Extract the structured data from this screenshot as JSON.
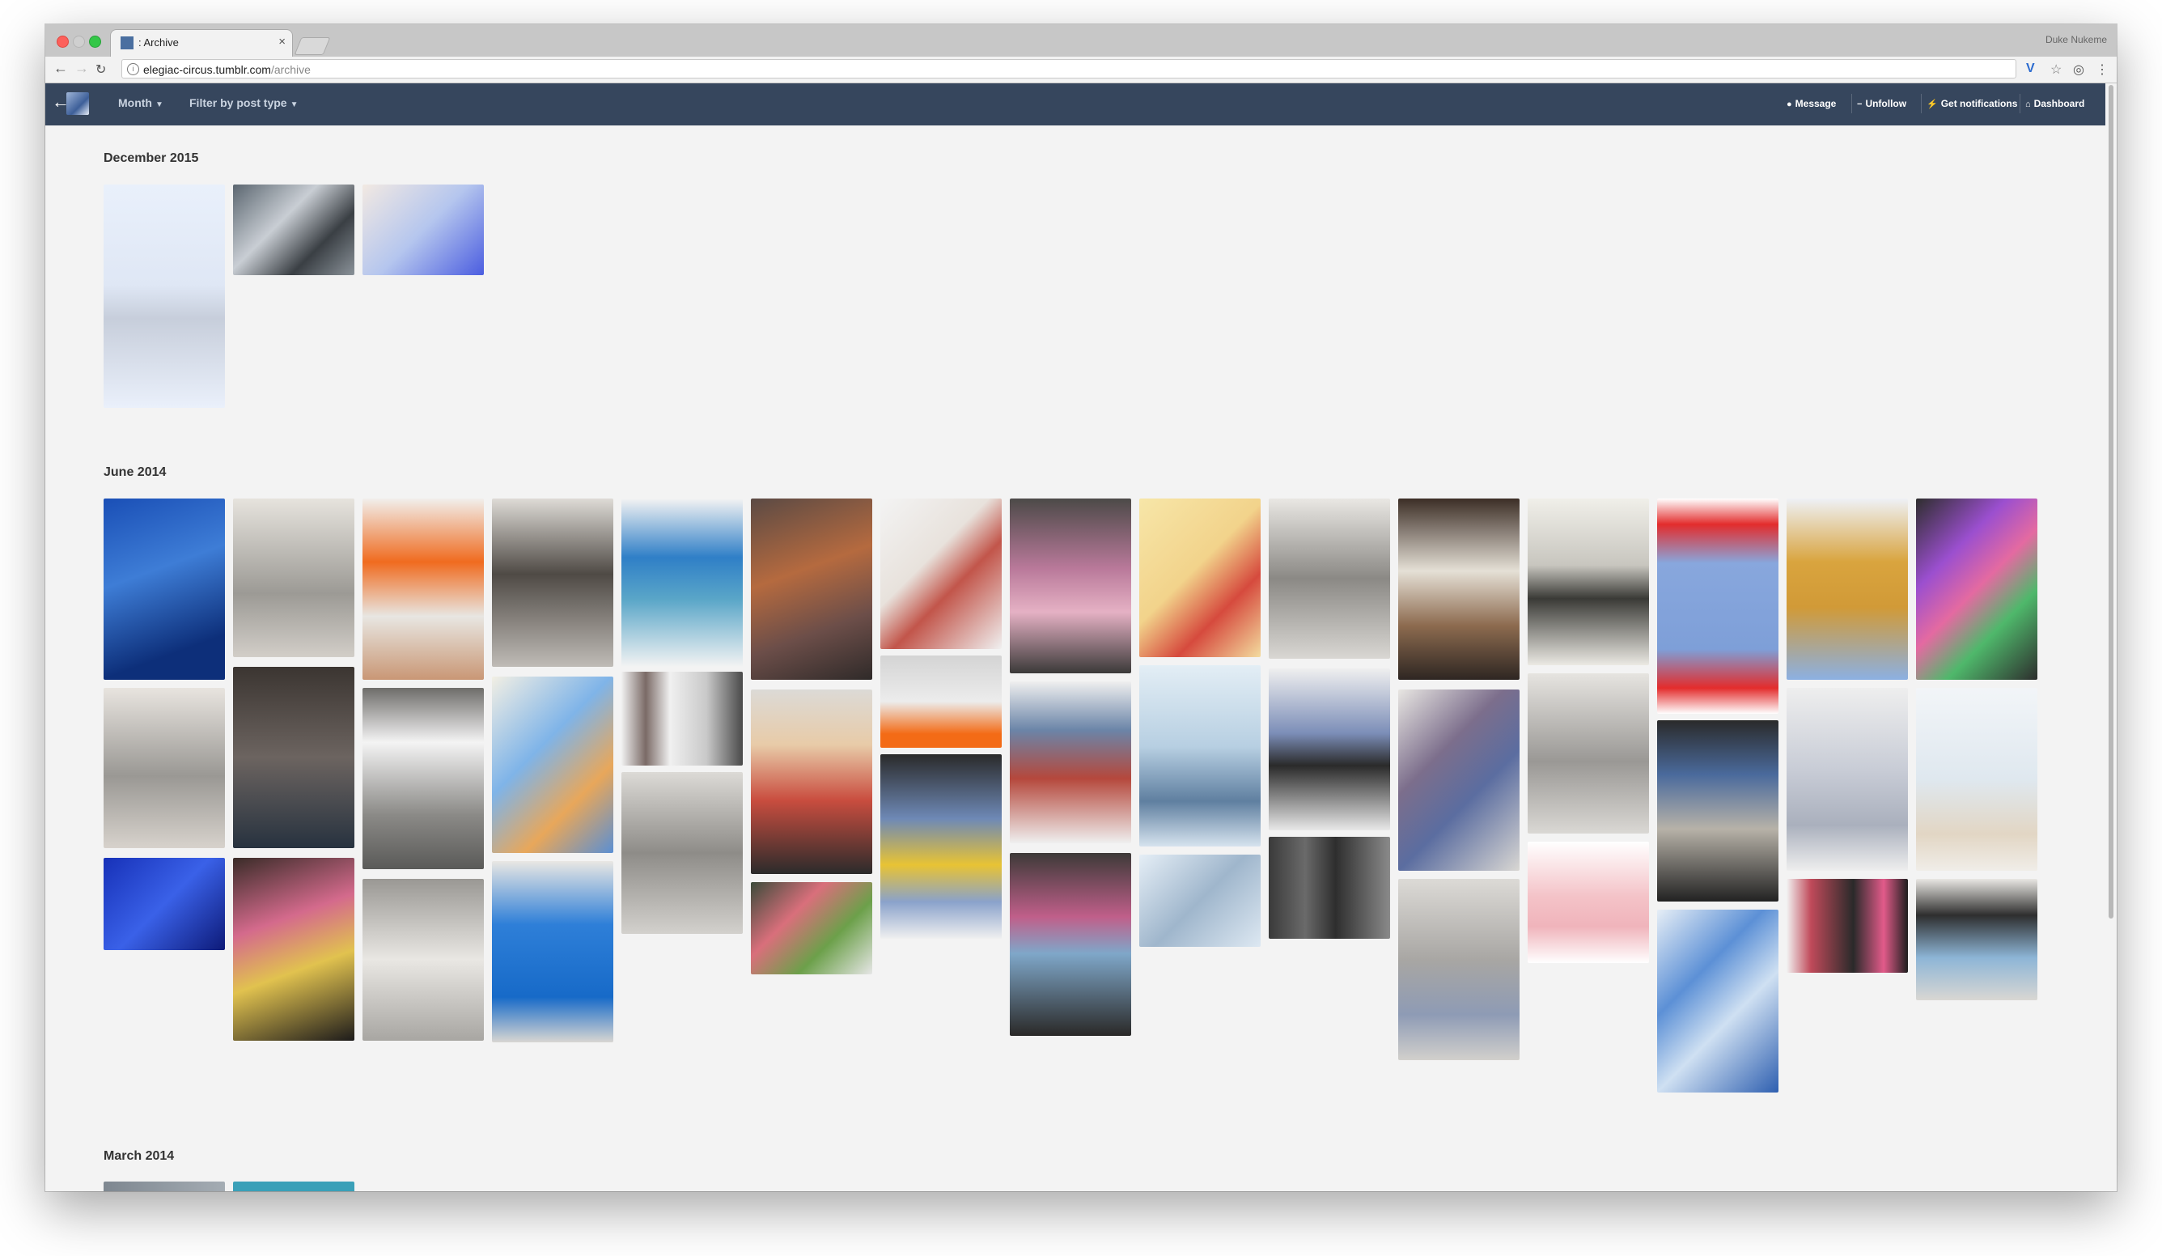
{
  "browser": {
    "tab_title": ": Archive",
    "tab_close": "×",
    "profile_name": "Duke Nukeme",
    "url_host": "elegiac-circus.tumblr.com",
    "url_path": "/archive",
    "back_icon": "back-arrow-icon",
    "forward_icon": "forward-arrow-icon",
    "reload_icon": "reload-icon"
  },
  "tumblr": {
    "month_label": "Month",
    "filter_label": "Filter by post type",
    "message_label": "Message",
    "unfollow_label": "Unfollow",
    "notifications_label": "Get notifications",
    "dashboard_label": "Dashboard"
  },
  "sections": {
    "dec2015": "December 2015",
    "jun2014": "June 2014",
    "mar2014": "March 2014"
  },
  "colors": {
    "tumblr_bar": "#36465d",
    "page_bg": "#f3f3f3"
  },
  "thumbnails": [
    "bg 1",
    "bg 2",
    "bg 3"
  ]
}
